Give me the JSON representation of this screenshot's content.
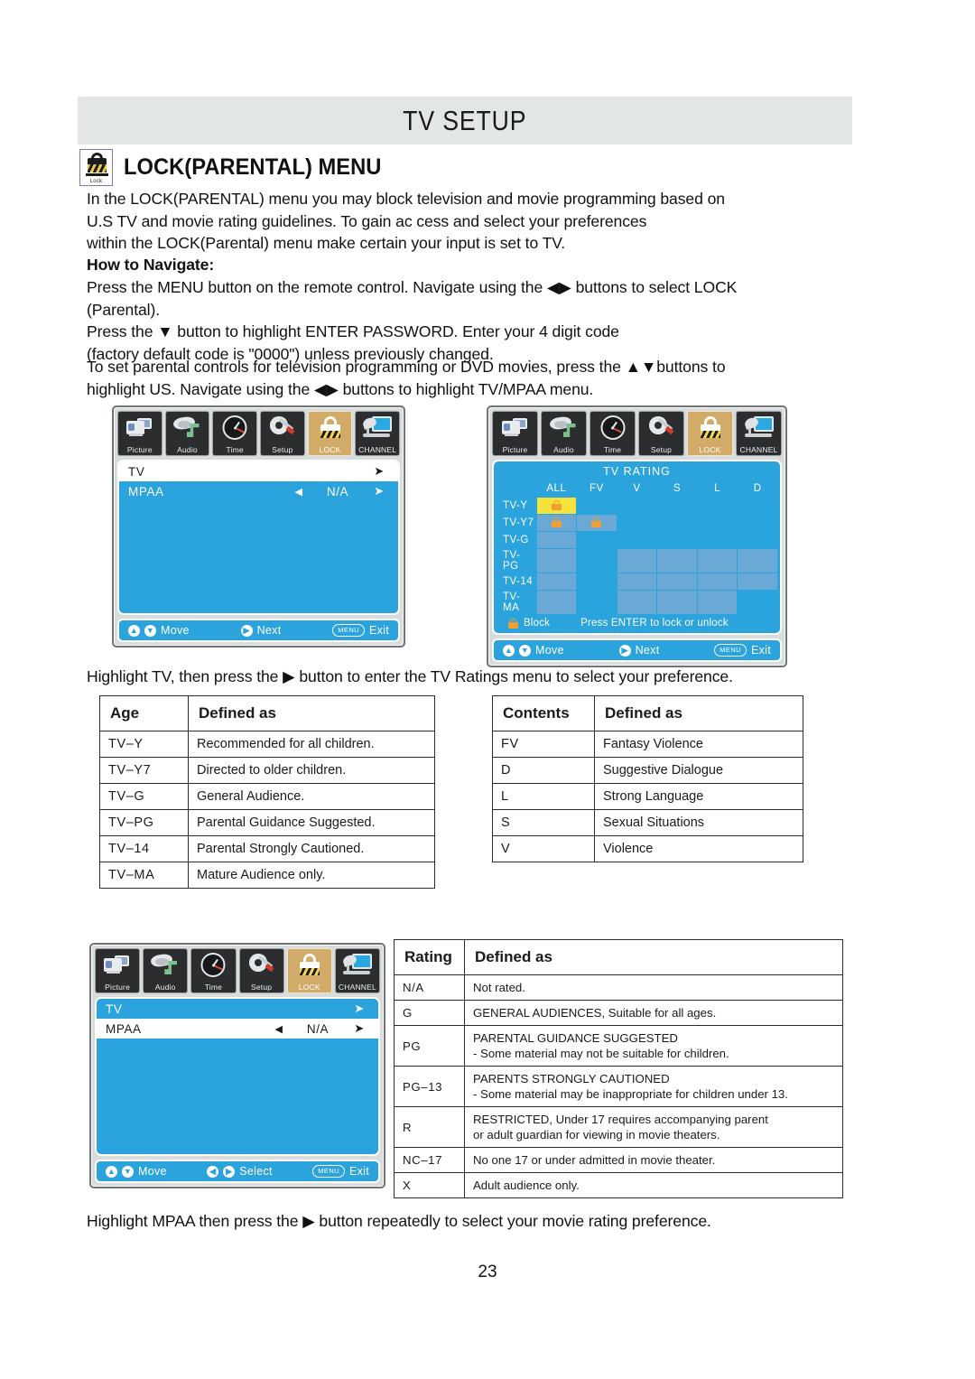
{
  "header": {
    "title": "TV SETUP"
  },
  "section": {
    "icon_label": "Lock",
    "title": "LOCK(PARENTAL) MENU"
  },
  "body": {
    "intro": "In the LOCK(PARENTAL) menu you may block television and movie programming based on\nU.S TV and movie rating guidelines. To gain ac cess and select your preferences\nwithin the LOCK(Parental) menu make certain your input is set to TV.",
    "how_to_navigate_heading": "How to Navigate:",
    "nav_para_1": "Press the MENU button on the remote control. Navigate using the ◀▶ buttons to select LOCK\n(Parental).\nPress the ▼ button to highlight ENTER PASSWORD. Enter your 4 digit code\n(factory default code is \"0000\") unless previously changed.",
    "nav_para_2": "To set parental controls for television programming or DVD movies, press the ▲▼buttons to\nhighlight US. Navigate using the ◀▶ buttons to highlight TV/MPAA menu.",
    "caption_1": "Highlight TV, then press the ▶ button to enter the TV Ratings menu to select your preference.",
    "caption_2": "Highlight MPAA then press the ▶ button repeatedly to select your movie rating preference.",
    "page_number": "23"
  },
  "osd": {
    "icons": [
      {
        "label": "Picture",
        "icon": "camera-icon",
        "active": false
      },
      {
        "label": "Audio",
        "icon": "speaker-note-icon",
        "active": false
      },
      {
        "label": "Time",
        "icon": "clock-icon",
        "active": false
      },
      {
        "label": "Setup",
        "icon": "gear-screwdriver-icon",
        "active": false
      },
      {
        "label": "LOCK",
        "icon": "padlock-icon",
        "active": true
      },
      {
        "label": "CHANNEL",
        "icon": "tv-antenna-icon",
        "active": false
      }
    ],
    "menu_1": {
      "rows": [
        {
          "name": "TV",
          "left": "",
          "value": "",
          "right": "➤",
          "selected": true
        },
        {
          "name": "MPAA",
          "left": "◀",
          "value": "N/A",
          "right": "➤",
          "selected": false
        }
      ],
      "footer": {
        "move": "Move",
        "action": "Next",
        "menu_key": "MENU",
        "exit": "Exit"
      }
    },
    "menu_3": {
      "rows": [
        {
          "name": "TV",
          "left": "",
          "value": "",
          "right": "➤",
          "selected": false
        },
        {
          "name": "MPAA",
          "left": "◀",
          "value": "N/A",
          "right": "➤",
          "selected": true
        }
      ],
      "footer": {
        "move": "Move",
        "action": "Select",
        "menu_key": "MENU",
        "exit": "Exit"
      }
    },
    "rating_grid": {
      "title": "TV  RATING",
      "columns": [
        "ALL",
        "FV",
        "V",
        "S",
        "L",
        "D"
      ],
      "rows": [
        {
          "label": "TV-Y",
          "cells": [
            "lock-highlight",
            "off",
            "off",
            "off",
            "off",
            "off"
          ]
        },
        {
          "label": "TV-Y7",
          "cells": [
            "lock",
            "lock",
            "off",
            "off",
            "off",
            "off"
          ]
        },
        {
          "label": "TV-G",
          "cells": [
            "dim",
            "off",
            "off",
            "off",
            "off",
            "off"
          ]
        },
        {
          "label": "TV-PG",
          "cells": [
            "dim",
            "off",
            "dim",
            "dim",
            "dim",
            "dim"
          ]
        },
        {
          "label": "TV-14",
          "cells": [
            "dim",
            "off",
            "dim",
            "dim",
            "dim",
            "dim"
          ]
        },
        {
          "label": "TV-MA",
          "cells": [
            "dim",
            "off",
            "dim",
            "dim",
            "dim",
            "off"
          ]
        }
      ],
      "block_label": "Block",
      "block_hint": "Press ENTER  to lock or unlock",
      "footer": {
        "move": "Move",
        "action": "Next",
        "menu_key": "MENU",
        "exit": "Exit"
      }
    }
  },
  "tables": {
    "age": {
      "headers": [
        "Age",
        "Defined as"
      ],
      "rows": [
        [
          "TV–Y",
          "Recommended for all children."
        ],
        [
          "TV–Y7",
          "Directed to older children."
        ],
        [
          "TV–G",
          "General Audience."
        ],
        [
          "TV–PG",
          "Parental Guidance Suggested."
        ],
        [
          "TV–14",
          "Parental Strongly Cautioned."
        ],
        [
          "TV–MA",
          "Mature Audience only."
        ]
      ]
    },
    "contents": {
      "headers": [
        "Contents",
        "Defined as"
      ],
      "rows": [
        [
          "FV",
          "Fantasy Violence"
        ],
        [
          "D",
          "Suggestive Dialogue"
        ],
        [
          "L",
          "Strong Language"
        ],
        [
          "S",
          "Sexual Situations"
        ],
        [
          "V",
          "Violence"
        ]
      ]
    },
    "mpaa": {
      "headers": [
        "Rating",
        "Defined as"
      ],
      "rows": [
        {
          "code": "N/A",
          "line1": "Not rated.",
          "line2": ""
        },
        {
          "code": "G",
          "line1": "GENERAL AUDIENCES, Suitable for all ages.",
          "line2": ""
        },
        {
          "code": "PG",
          "line1": "PARENTAL GUIDANCE SUGGESTED",
          "line2": "- Some material may not be suitable for children."
        },
        {
          "code": "PG–13",
          "line1": "PARENTS STRONGLY CAUTIONED",
          "line2": "- Some material may be inappropriate for children under 13."
        },
        {
          "code": "R",
          "line1": "RESTRICTED, Under 17 requires accompanying parent",
          "line2": "or adult guardian for viewing in movie theaters."
        },
        {
          "code": "NC–17",
          "line1": "No one 17 or under admitted in movie theater.",
          "line2": ""
        },
        {
          "code": "X",
          "line1": "Adult audience only.",
          "line2": ""
        }
      ]
    }
  },
  "colors": {
    "banner_bg": "#e3e6e6",
    "osd_blue": "#2ba3dd",
    "osd_dim": "#6aa9d5",
    "highlight_yellow": "#f5e23a",
    "lock_tab": "#d3ab68",
    "lock_orange": "#f0a030"
  }
}
